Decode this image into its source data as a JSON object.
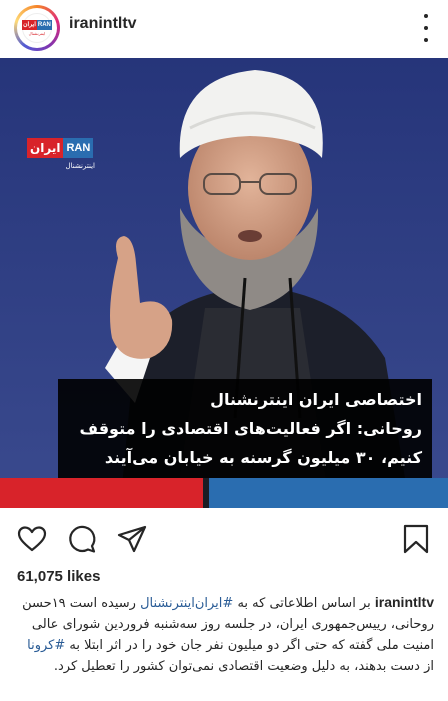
{
  "post": {
    "username": "iranintltv",
    "avatar_logo": {
      "fa": "ایران",
      "en": "RAN",
      "tag": "اینترنشنال"
    },
    "image": {
      "logo_fa": "ایران",
      "logo_en": "RAN",
      "logo_sub": "اینترنشنال",
      "caption_lines": [
        "اختصاصی ایران اینترنشنال",
        "روحانی: اگر فعالیت‌های اقتصادی را متوقف",
        "کنیم، ۳۰ میلیون گرسنه به خیابان می‌آیند"
      ],
      "colors": {
        "red": "#d8232a",
        "blue": "#2a6db0",
        "background": "#2a3a7a"
      }
    },
    "likes": "61,075 likes",
    "caption": {
      "user": "iranintltv",
      "part1": "بر اساس اطلاعاتی که به ",
      "hashtag1": "#ایران‌اینترنشنال",
      "part2": " رسیده است ۱۹حسن روحانی، رییس‌جمهوری ایران، در جلسه روز سه‌شنبه فروردین شورای عالی امنیت ملی گفته که حتی اگر دو میلیون نفر جان خود را در اثر ابتلا به ",
      "hashtag2": "#کرونا",
      "part3": " از دست بدهند، به دلیل وضعیت اقتصادی نمی‌توان کشور را تعطیل کرد."
    }
  },
  "icons": {
    "more": "more-options-icon",
    "like": "heart-icon",
    "comment": "comment-icon",
    "share": "share-icon",
    "save": "bookmark-icon"
  }
}
